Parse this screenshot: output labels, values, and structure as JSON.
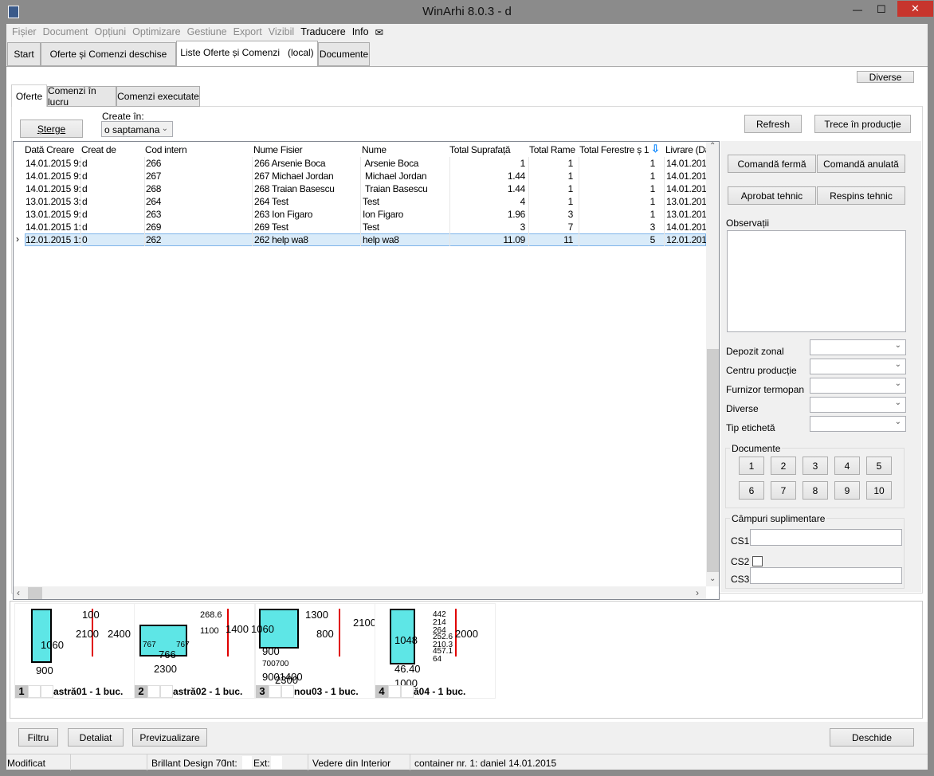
{
  "window": {
    "title": "WinArhi 8.0.3 - d",
    "minimize": "—",
    "maximize": "☐",
    "close": "✕"
  },
  "menu": [
    "Fișier",
    "Document",
    "Opțiuni",
    "Optimizare",
    "Gestiune",
    "Export",
    "Vizibil",
    "Traducere",
    "Info"
  ],
  "main_tabs": [
    "Start",
    "Oferte și Comenzi deschise",
    "Liste Oferte și Comenzi   (local)",
    "Documente"
  ],
  "diverse_button": "Diverse",
  "sub_tabs": [
    "Oferte",
    "Comenzi în lucru",
    "Comenzi executate"
  ],
  "toolbar": {
    "delete": "Șterge",
    "created_label": "Create în:",
    "created_value": "o saptamana",
    "refresh": "Refresh",
    "to_production": "Trece în producție"
  },
  "table": {
    "columns": [
      "Dată Creare",
      "Creat de",
      "Cod intern",
      "Nume Fisier",
      "Nume",
      "Total Suprafață",
      "Total Rame",
      "Total Ferestre ș 1",
      "Livrare (Da"
    ],
    "rows": [
      [
        "14.01.2015 9:",
        "d",
        "266",
        "266 Arsenie Boca",
        " Arsenie Boca",
        "1",
        "1",
        "1",
        "14.01.201"
      ],
      [
        "14.01.2015 9:",
        "d",
        "267",
        "267 Michael Jordan",
        " Michael Jordan",
        "1.44",
        "1",
        "1",
        "14.01.201"
      ],
      [
        "14.01.2015 9:",
        "d",
        "268",
        "268 Traian Basescu",
        " Traian Basescu",
        "1.44",
        "1",
        "1",
        "14.01.201"
      ],
      [
        "13.01.2015 3:",
        "d",
        "264",
        "264 Test",
        "Test",
        "4",
        "1",
        "1",
        "13.01.201"
      ],
      [
        "13.01.2015 9:",
        "d",
        "263",
        "263 Ion Figaro",
        "Ion Figaro",
        "1.96",
        "3",
        "1",
        "13.01.201"
      ],
      [
        "14.01.2015 1:",
        "d",
        "269",
        "269 Test",
        "Test",
        "3",
        "7",
        "3",
        "14.01.201"
      ],
      [
        "12.01.2015 1:",
        "0",
        "262",
        "262 help wa8",
        "help wa8",
        "11.09",
        "11",
        "5",
        "12.01.201"
      ]
    ],
    "selected_row": 6
  },
  "right_panel": {
    "firm_order": "Comandă fermă",
    "cancel_order": "Comandă anulată",
    "tech_approved": "Aprobat tehnic",
    "tech_rejected": "Respins tehnic",
    "notes_label": "Observații",
    "fields": [
      "Depozit zonal",
      "Centru producție",
      "Furnizor termopan",
      "Diverse",
      "Tip etichetă"
    ],
    "documents_label": "Documente",
    "documents": [
      "1",
      "2",
      "3",
      "4",
      "5",
      "6",
      "7",
      "8",
      "9",
      "10"
    ],
    "extra_label": "Câmpuri suplimentare",
    "cs1": "CS1",
    "cs2": "CS2",
    "cs3": "CS3"
  },
  "thumbnails": [
    {
      "num": "1",
      "caption": "astră01 - 1 buc.",
      "dims": [
        "100",
        "2100",
        "2400",
        "1060",
        "900"
      ]
    },
    {
      "num": "2",
      "caption": "astră02 - 1 buc.",
      "dims": [
        "268.6",
        "1100",
        "1400",
        "766",
        "2300",
        "767",
        "767"
      ]
    },
    {
      "num": "3",
      "caption": "nou03 - 1 buc.",
      "dims": [
        "1300",
        "800",
        "2100",
        "1060",
        "900",
        "700700",
        "9001400",
        "2300"
      ]
    },
    {
      "num": "4",
      "caption": "ă04 - 1 buc.",
      "dims": [
        "442",
        "214",
        "264",
        "252.6",
        "210.3",
        "457.1",
        "64",
        "2000",
        "1048",
        "46.40",
        "1000"
      ]
    }
  ],
  "bottom": {
    "filter": "Filtru",
    "detailed": "Detaliat",
    "preview": "Previzualizare",
    "open": "Deschide"
  },
  "status": {
    "state": "Modificat",
    "system": "Brillant Design 70",
    "int": "Int:",
    "ext": "Ext:",
    "view": "Vedere din Interior",
    "container": "container nr. 1: daniel 14.01.2015"
  },
  "colors": {
    "accent": "#1e90ff",
    "glass": "#5ee6e6",
    "dimension": "#e00000",
    "selected_row": "#d9ebf9"
  }
}
